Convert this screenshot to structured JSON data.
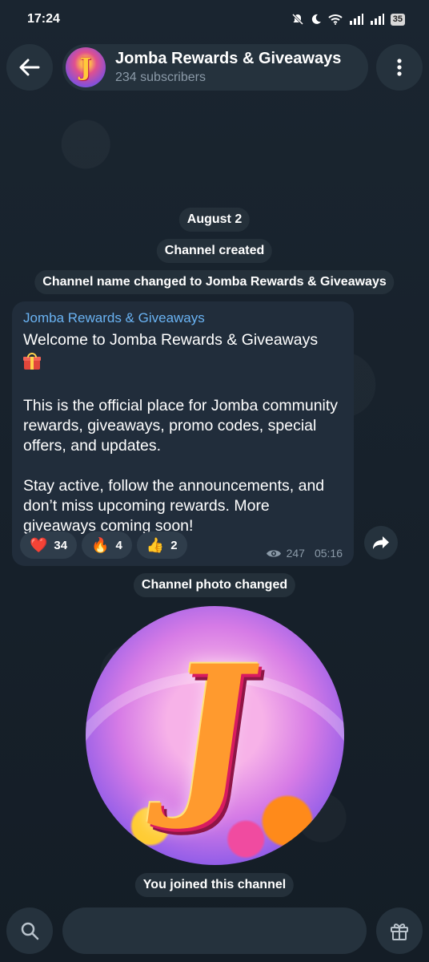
{
  "status_bar": {
    "time": "17:24",
    "battery": "35",
    "icons": [
      "mute-icon",
      "moon-icon",
      "wifi-icon",
      "signal-icon",
      "signal-icon",
      "battery-icon"
    ]
  },
  "header": {
    "back_icon": "arrow-left-icon",
    "avatar_letter": "J",
    "title": "Jomba Rewards & Giveaways",
    "subtitle": "234 subscribers",
    "menu_icon": "more-vertical-icon"
  },
  "service": {
    "date": "August 2",
    "created": "Channel created",
    "renamed": "Channel name changed to Jomba Rewards & Giveaways",
    "photo_changed": "Channel photo changed",
    "joined": "You joined this channel"
  },
  "message": {
    "author": "Jomba Rewards & Giveaways",
    "line1": "Welcome to Jomba Rewards & Giveaways",
    "emoji": "gift-icon",
    "para2": "This is the official place for Jomba community rewards, giveaways, promo codes, special offers, and updates.",
    "para3": "Stay active, follow the announcements, and don’t miss upcoming rewards. More giveaways coming soon!",
    "reactions": [
      {
        "icon": "❤️",
        "count": "34"
      },
      {
        "icon": "🔥",
        "count": "4"
      },
      {
        "icon": "👍",
        "count": "2"
      }
    ],
    "views": "247",
    "time": "05:16"
  },
  "photo": {
    "letter": "J"
  },
  "bottom": {
    "search_icon": "search-icon",
    "gift_icon": "gift-icon"
  },
  "colors": {
    "background": "#17212b",
    "bubble": "#212d3b",
    "author": "#6ab3f3",
    "pill": "#25323d"
  }
}
